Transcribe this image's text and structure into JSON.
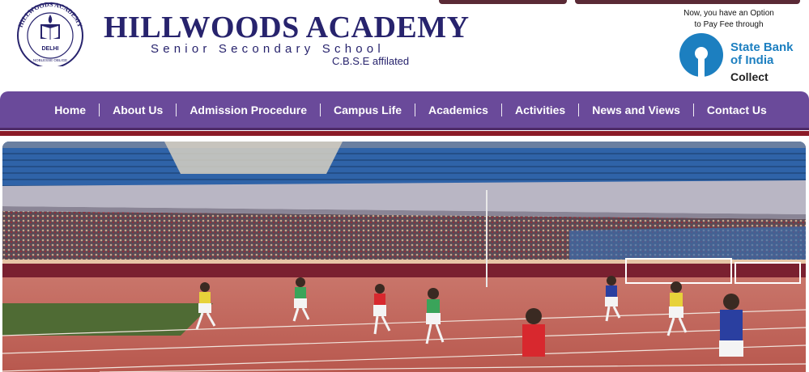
{
  "header": {
    "brand_title": "HILLWOODS ACADEMY",
    "brand_subtitle": "Senior Secondary School",
    "brand_affiliation": "C.B.S.E affilated",
    "logo": {
      "top_text": "HILLWOODS ACADEMY",
      "city": "DELHI",
      "motto": "NOBLESSE OBLIGE"
    }
  },
  "fee": {
    "note_line1": "Now, you have an Option",
    "note_line2": "to Pay Fee through",
    "bank_line1": "State Bank",
    "bank_line2": "of India",
    "collect": "Collect"
  },
  "nav": {
    "items": [
      {
        "label": "Home"
      },
      {
        "label": "About Us"
      },
      {
        "label": "Admission Procedure"
      },
      {
        "label": "Campus Life"
      },
      {
        "label": "Academics"
      },
      {
        "label": "Activities"
      },
      {
        "label": "News and Views"
      },
      {
        "label": "Contact Us"
      }
    ]
  },
  "banner": {
    "description_icon": "stadium-photo"
  },
  "colors": {
    "brand_navy": "#27236d",
    "nav_purple": "#6a4a9a",
    "accent_maroon": "#8b1b28",
    "sbi_blue": "#1c7fc0"
  }
}
